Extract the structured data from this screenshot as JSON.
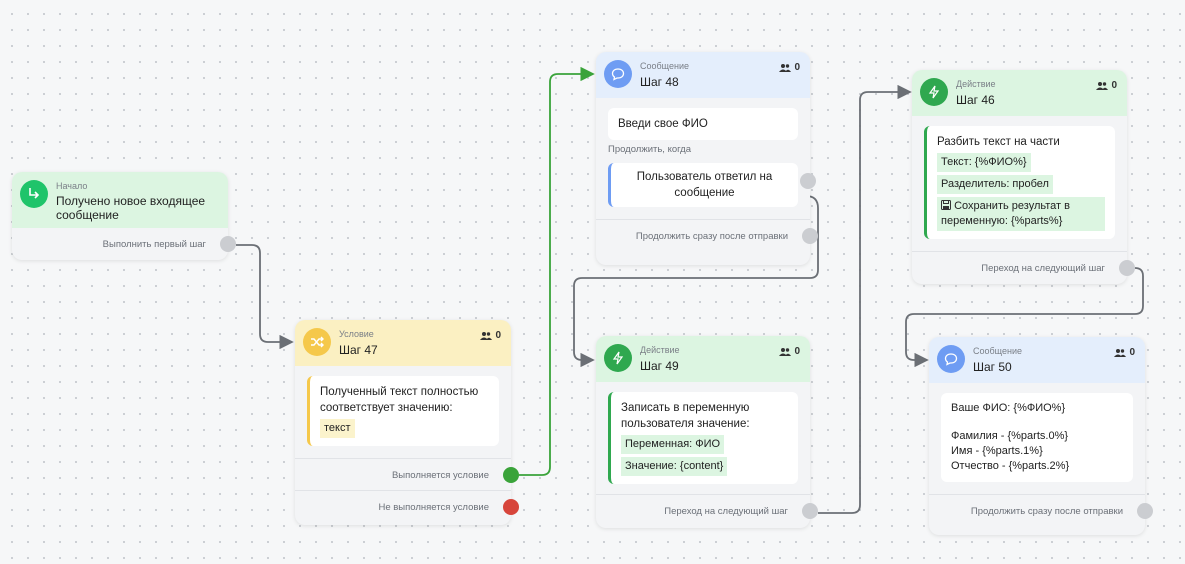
{
  "nodes": {
    "start": {
      "category": "Начало",
      "title": "Получено новое входящее сообщение",
      "out": "Выполнить первый шаг"
    },
    "s47": {
      "category": "Условие",
      "step": "Шаг 47",
      "count": "0",
      "condition": "Полученный текст полностью соответствует значению:",
      "value": "текст",
      "out_yes": "Выполняется условие",
      "out_no": "Не выполняется условие"
    },
    "s48": {
      "category": "Сообщение",
      "step": "Шаг 48",
      "count": "0",
      "message": "Введи свое ФИО",
      "continue_label": "Продолжить, когда",
      "reply_condition": "Пользователь ответил на сообщение",
      "out": "Продолжить сразу после отправки"
    },
    "s49": {
      "category": "Действие",
      "step": "Шаг 49",
      "count": "0",
      "action": "Записать в переменную пользователя значение:",
      "var": "Переменная: ФИО",
      "val": "Значение: {content}",
      "out": "Переход на следующий шаг"
    },
    "s46": {
      "category": "Действие",
      "step": "Шаг 46",
      "count": "0",
      "action": "Разбить текст на части",
      "text": "Текст: {%ФИО%}",
      "separator": "Разделитель: пробел",
      "save": "Сохранить результат в переменную: {%parts%}",
      "out": "Переход на следующий шаг"
    },
    "s50": {
      "category": "Сообщение",
      "step": "Шаг 50",
      "count": "0",
      "line1": "Ваше ФИО: {%ФИО%}",
      "line2": "Фамилия - {%parts.0%}",
      "line3": "Имя - {%parts.1%}",
      "line4": "Отчество - {%parts.2%}",
      "out": "Продолжить сразу после отправки"
    }
  },
  "colors": {
    "success": "#3aa33a",
    "fail": "#d7453b",
    "edge_gray": "#6b6f75"
  }
}
